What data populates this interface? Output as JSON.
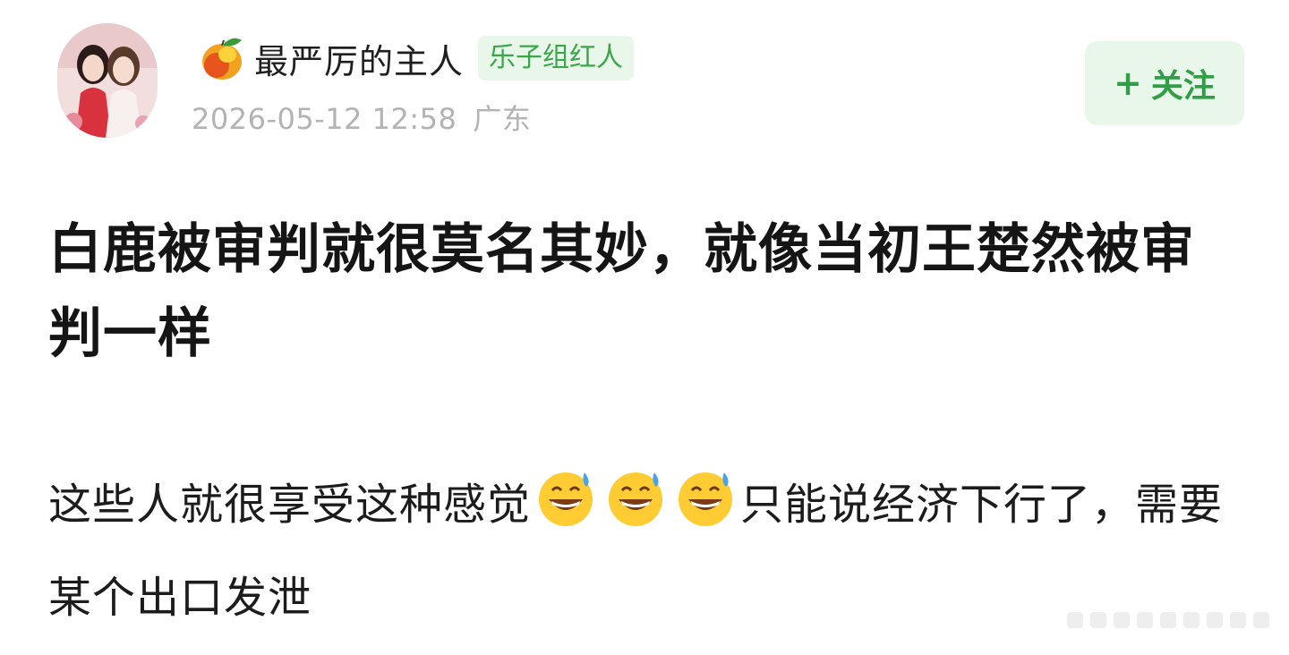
{
  "post": {
    "username": "最严厉的主人",
    "tag": "乐子组红人",
    "datetime": "2026-05-12 12:58",
    "location": "广东",
    "follow_label": "关注",
    "follow_plus": "+",
    "title": "白鹿被审判就很莫名其妙，就像当初王楚然被审判一样",
    "body_part1": "这些人就很享受这种感觉",
    "body_part2": "只能说经济下行了，需要某个出口发泄"
  },
  "icons": {
    "user_badge": "mango-icon",
    "emoji": "grinning-sweat-emoji"
  },
  "colors": {
    "tag_text": "#3aa84a",
    "tag_bg": "#e9f7ea",
    "follow_text": "#2f9e46",
    "follow_bg": "#e8f7ea",
    "meta_text": "#b3b3b3"
  }
}
